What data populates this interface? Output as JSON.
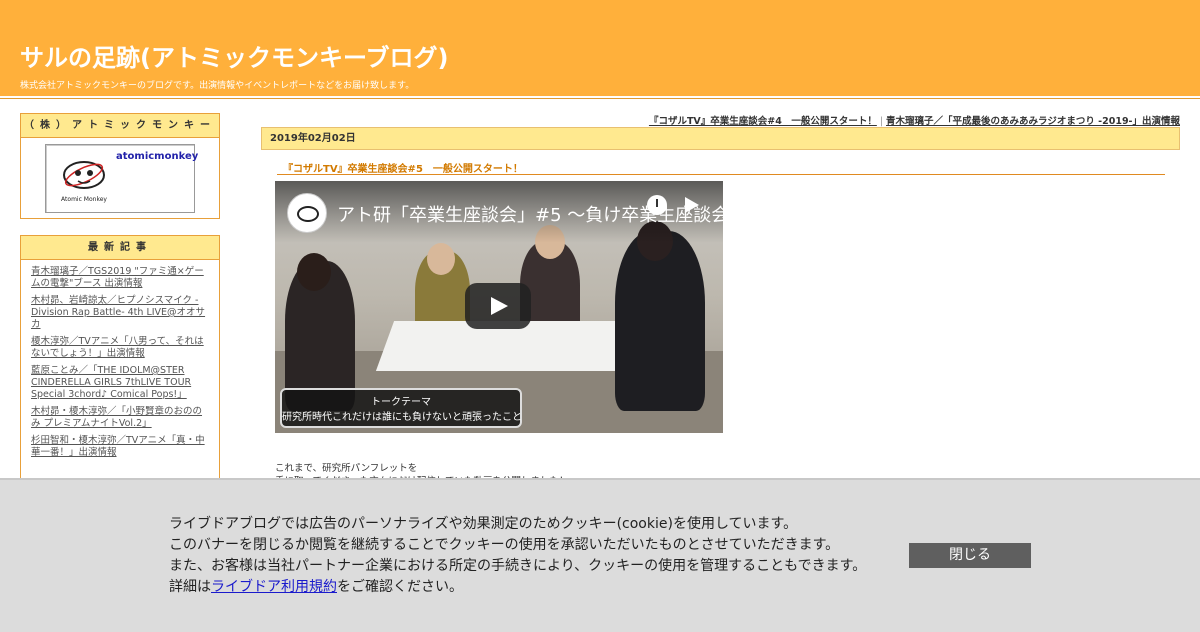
{
  "header": {
    "title": "サルの足跡(アトミックモンキーブログ)",
    "description": "株式会社アトミックモンキーのブログです。出演情報やイベントレポートなどをお届け致します。"
  },
  "sidebar": {
    "profile": {
      "heading": "（株）アトミックモンキー",
      "name": "atomicmonkey",
      "logo_text": "Atomic Monkey"
    },
    "recent": {
      "heading": "最新記事",
      "items": [
        "青木瑠璃子／TGS2019 \"ファミ通×ゲームの電撃\"ブース 出演情報",
        "木村昴、岩崎諒太／ヒプノシスマイク -Division Rap Battle- 4th LIVE@オオサカ",
        "榎木淳弥／TVアニメ「八男って、それはないでしょう！」出演情報",
        "藍原ことみ／「THE IDOLM@STER CINDERELLA GIRLS 7thLIVE TOUR Special 3chord♪ Comical Pops!」",
        "木村昴・榎木淳弥／「小野賢章のおののみ プレミアムナイトVol.2」",
        "杉田智和・榎木淳弥／TVアニメ「真・中華一番！」出演情報"
      ]
    }
  },
  "nav": {
    "prev": "『コザルTV』卒業生座談会#4　一般公開スタート！",
    "separator": "|",
    "next": "青木瑠璃子／「平成最後のあみあみラジオまつり -2019-」出演情報"
  },
  "post": {
    "date": "2019年02月02日",
    "title": "『コザルTV』卒業生座談会#5　一般公開スタート！",
    "video": {
      "title": "アト研「卒業生座談会」#5 〜負け",
      "overlay_title": "卒業生座談会",
      "topic_label": "トークテーマ",
      "topic_text": "研究所時代これだけは誰にも負けないと頑張ったこと"
    },
    "body": [
      "これまで、研究所パンフレットを",
      "手に取ってくださった方々にだけ配信していた動画を公開しました！"
    ]
  },
  "cookie": {
    "lines": [
      "ライブドアブログでは広告のパーソナライズや効果測定のためクッキー(cookie)を使用しています。",
      "このバナーを閉じるか閲覧を継続することでクッキーの使用を承認いただいたものとさせていただきます。",
      "また、お客様は当社パートナー企業における所定の手続きにより、クッキーの使用を管理することもできます。"
    ],
    "last_prefix": "詳細は",
    "link": "ライブドア利用規約",
    "last_suffix": "をご確認ください。",
    "close_label": "閉じる"
  }
}
